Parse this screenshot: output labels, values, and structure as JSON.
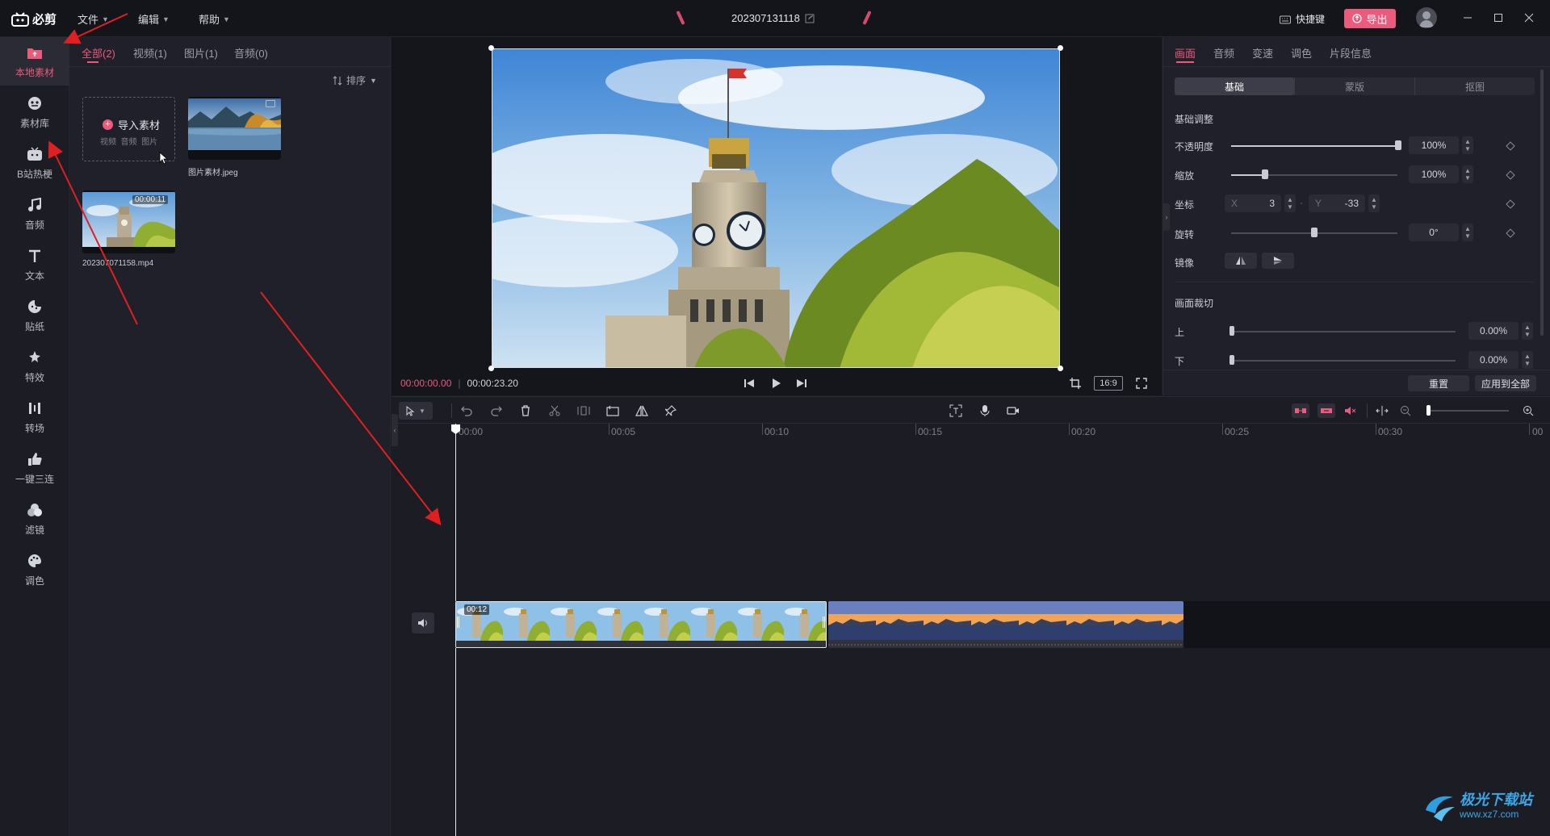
{
  "titlebar": {
    "app_name": "必剪",
    "menus": [
      "文件",
      "编辑",
      "帮助"
    ],
    "project_name": "202307131118",
    "shortcut_label": "快捷键",
    "export_label": "导出"
  },
  "rail": {
    "items": [
      {
        "label": "本地素材",
        "icon": "folder-icon"
      },
      {
        "label": "素材库",
        "icon": "library-icon"
      },
      {
        "label": "B站热梗",
        "icon": "tv-icon"
      },
      {
        "label": "音频",
        "icon": "music-icon"
      },
      {
        "label": "文本",
        "icon": "text-icon"
      },
      {
        "label": "贴纸",
        "icon": "sticker-icon"
      },
      {
        "label": "特效",
        "icon": "effect-icon"
      },
      {
        "label": "转场",
        "icon": "transition-icon"
      },
      {
        "label": "一键三连",
        "icon": "thumbs-up-icon"
      },
      {
        "label": "滤镜",
        "icon": "filter-icon"
      },
      {
        "label": "调色",
        "icon": "palette-icon"
      }
    ]
  },
  "media": {
    "tabs": [
      "全部(2)",
      "视频(1)",
      "图片(1)",
      "音频(0)"
    ],
    "sort_label": "排序",
    "import_label": "导入素材",
    "import_hint": "视频  音频  图片",
    "items": [
      {
        "name": "图片素材.jpeg"
      },
      {
        "name": "202307071158.mp4",
        "duration": "00:00:11"
      }
    ]
  },
  "preview": {
    "current_time": "00:00:00.00",
    "total_time": "00:00:23.20",
    "ratio": "16:9"
  },
  "props": {
    "tabs": [
      "画面",
      "音频",
      "变速",
      "调色",
      "片段信息"
    ],
    "subtabs": [
      "基础",
      "蒙版",
      "抠图"
    ],
    "section_basic": "基础调整",
    "opacity_label": "不透明度",
    "opacity_value": "100%",
    "opacity_level": 1.0,
    "scale_label": "缩放",
    "scale_value": "100%",
    "position_label": "坐标",
    "x_label": "X",
    "x_value": "3",
    "y_label": "Y",
    "y_value": "-33",
    "rotate_label": "旋转",
    "rotate_value": "0°",
    "mirror_label": "镜像",
    "section_crop": "画面裁切",
    "crop_top_label": "上",
    "crop_top_value": "0.00%",
    "crop_bottom_label": "下",
    "crop_bottom_value": "0.00%",
    "reset_label": "重置",
    "apply_all_label": "应用到全部"
  },
  "timeline": {
    "ruler": [
      "00:00",
      "00:05",
      "00:10",
      "00:15",
      "00:20",
      "00:25",
      "00:30",
      "00"
    ],
    "clip1_label": "00:12"
  },
  "watermark": {
    "title": "极光下载站",
    "url": "www.xz7.com"
  },
  "colors": {
    "accent": "#ec5a7c",
    "annotation_arrow": "#e02020"
  }
}
